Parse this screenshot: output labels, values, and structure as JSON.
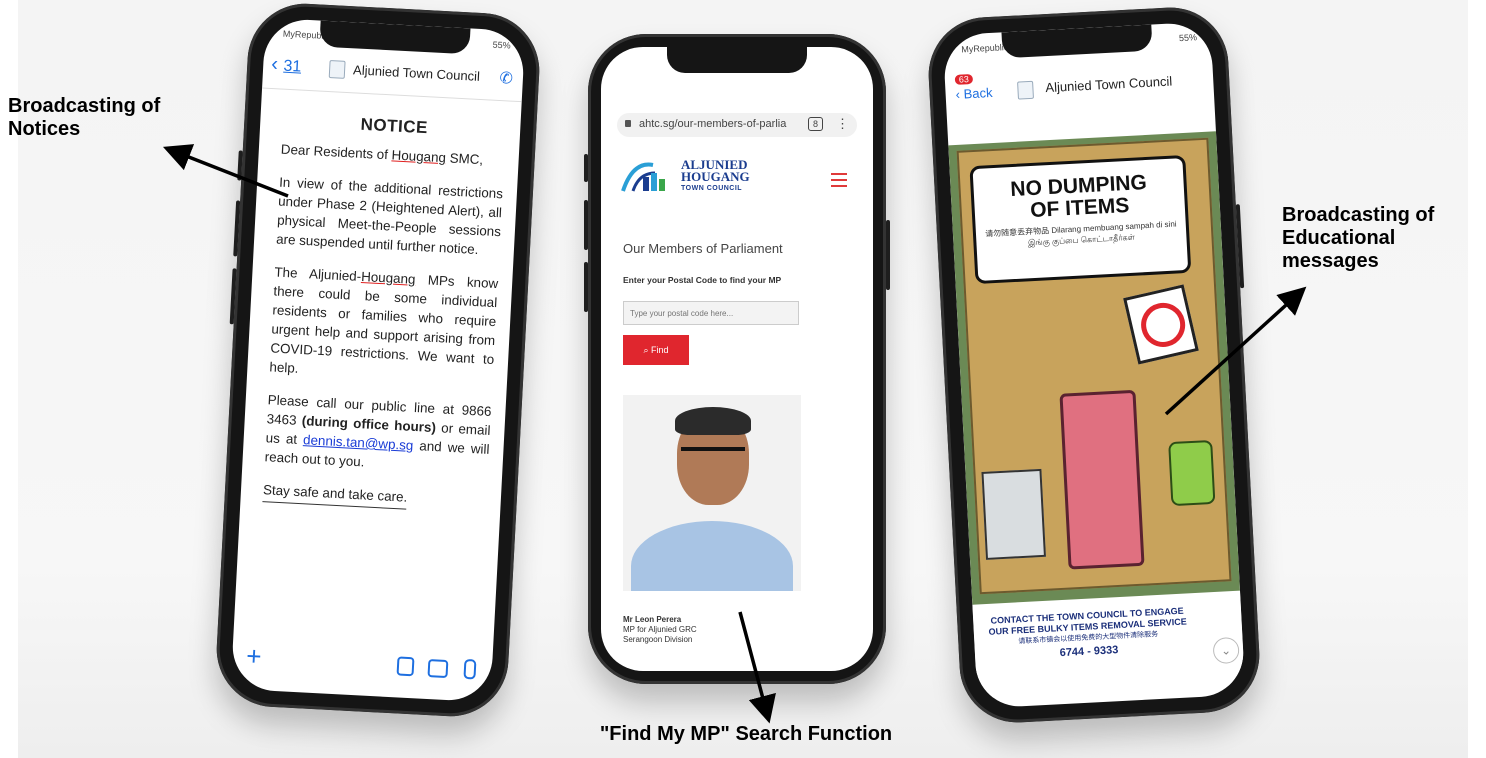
{
  "captions": {
    "notices": "Broadcasting of Notices",
    "educational": "Broadcasting of Educational messages",
    "find_mp": "\"Find My MP\" Search Function"
  },
  "phone1": {
    "carrier": "MyRepublic",
    "battery": "55%",
    "back_count": "31",
    "chat_name": "Aljunied Town Council",
    "notice": {
      "title": "NOTICE",
      "greeting_prefix": "Dear Residents of",
      "greeting_place": "Hougang",
      "greeting_suffix": "SMC,",
      "para1": "In view of the additional restrictions under Phase 2 (Heightened Alert), all physical Meet-the-People sessions are suspended until further notice.",
      "para2_prefix": "The Aljunied-",
      "para2_place": "Hougang",
      "para2_rest": "MPs know there could be some individual residents or families who require urgent help and support arising from COVID-19 restrictions. We want to help.",
      "para3_a": "Please call our public line at 9866 3463",
      "para3_b": "(during office hours)",
      "para3_c": "or email us at",
      "email": "dennis.tan@wp.sg",
      "para3_d": "and we will reach out to you.",
      "closing": "Stay safe and take care."
    }
  },
  "phone2": {
    "url": "ahtc.sg/our-members-of-parlia",
    "tab_count": "8",
    "logo_line1": "ALJUNIED",
    "logo_line2": "HOUGANG",
    "logo_line3": "TOWN COUNCIL",
    "section_title": "Our Members of Parliament",
    "prompt": "Enter your Postal Code to find your MP",
    "placeholder": "Type your postal code here...",
    "find_label": "Find",
    "mp_name": "Mr Leon Perera",
    "mp_role": "MP for Aljunied GRC",
    "mp_division": "Serangoon Division"
  },
  "phone3": {
    "carrier": "MyRepublic",
    "battery": "55%",
    "unread": "63",
    "back_label": "Back",
    "chat_name": "Aljunied Town Council",
    "poster_title_1": "NO DUMPING",
    "poster_title_2": "OF ITEMS",
    "poster_sub_1": "请勿随意丢弃物品  Dilarang membuang sampah di sini",
    "poster_sub_2": "இங்கு குப்பை கொட்டாதீர்கள்",
    "footer_1": "CONTACT THE TOWN COUNCIL TO ENGAGE",
    "footer_2": "OUR FREE BULKY ITEMS REMOVAL SERVICE",
    "footer_3": "请联系市镇会以使用免费的大型物件清除服务",
    "phone_number": "6744 - 9333"
  },
  "colors": {
    "accent_red": "#e0262e",
    "link_blue": "#1a3cd6",
    "brand_blue": "#1b3d8f",
    "ios_blue": "#1e6fe0"
  }
}
